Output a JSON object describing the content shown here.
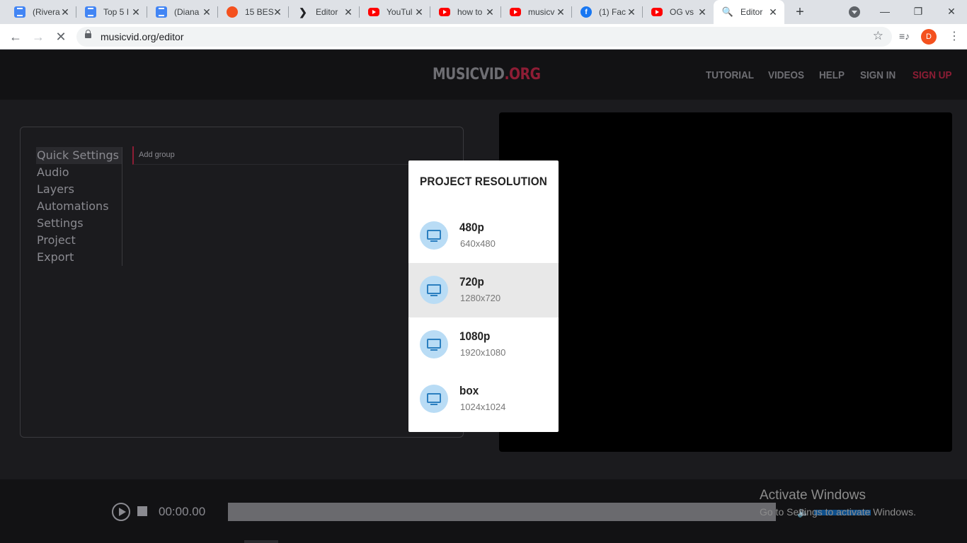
{
  "browser": {
    "tabs": [
      {
        "title": "(Rivera",
        "favicon": "docs-icon"
      },
      {
        "title": "Top 5 I",
        "favicon": "docs-icon"
      },
      {
        "title": "(Diana",
        "favicon": "docs-icon"
      },
      {
        "title": "15 BES",
        "favicon": "orange-site-icon"
      },
      {
        "title": "Editor",
        "favicon": "editor-icon"
      },
      {
        "title": "YouTul",
        "favicon": "youtube-icon"
      },
      {
        "title": "how to",
        "favicon": "youtube-icon"
      },
      {
        "title": "musicv",
        "favicon": "youtube-icon"
      },
      {
        "title": "(1) Fac",
        "favicon": "facebook-icon"
      },
      {
        "title": "OG vs",
        "favicon": "youtube-icon"
      },
      {
        "title": "Editor",
        "favicon": "search-icon",
        "active": true
      }
    ],
    "url": "musicvid.org/editor",
    "profile_initial": "D",
    "icons": {
      "back": "back-arrow-icon",
      "forward": "forward-arrow-icon",
      "stop": "stop-loading-icon"
    }
  },
  "site": {
    "logo_main": "MUSICVID",
    "logo_tld": ".ORG",
    "nav": {
      "tutorial": "TUTORIAL",
      "videos": "VIDEOS",
      "help": "HELP",
      "signin": "SIGN IN",
      "signup": "SIGN UP"
    },
    "colors": {
      "accent": "#8e1d35",
      "header_bg": "#121214",
      "modal_icon_bg": "#b9dcf5"
    }
  },
  "side_menu": [
    "Quick Settings",
    "Audio",
    "Layers",
    "Automations",
    "Settings",
    "Project",
    "Export"
  ],
  "add_group_label": "Add group",
  "modal": {
    "title": "PROJECT RESOLUTION",
    "options": [
      {
        "name": "480p",
        "dims": "640x480"
      },
      {
        "name": "720p",
        "dims": "1280x720",
        "hovered": true
      },
      {
        "name": "1080p",
        "dims": "1920x1080"
      },
      {
        "name": "box",
        "dims": "1024x1024"
      }
    ]
  },
  "player": {
    "timecode": "00:00.00"
  },
  "watermark": {
    "line1": "Activate Windows",
    "line2": "Go to Settings to activate Windows."
  }
}
